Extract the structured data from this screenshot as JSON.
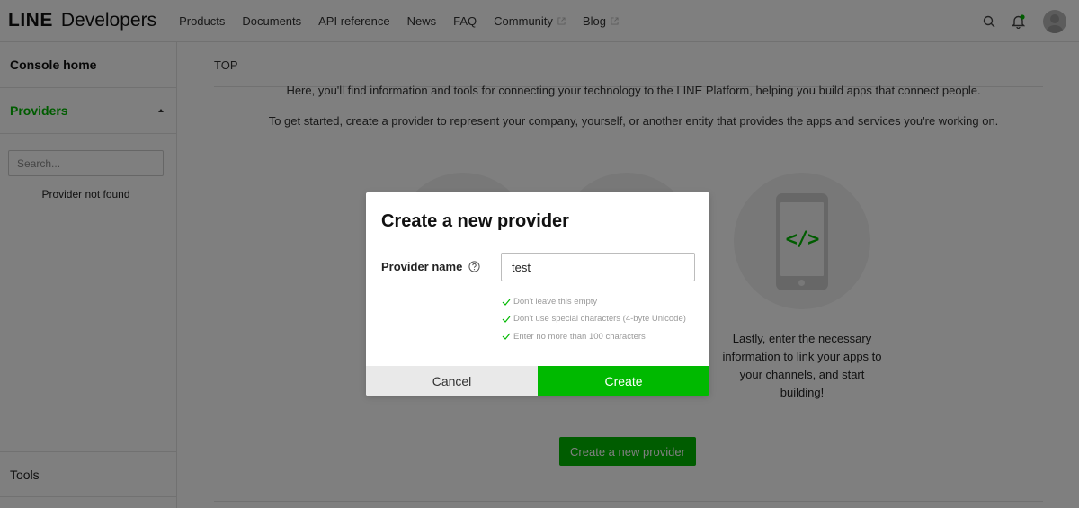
{
  "header": {
    "logo_brand": "LINE",
    "logo_product": "Developers",
    "nav": [
      {
        "label": "Products",
        "external": false
      },
      {
        "label": "Documents",
        "external": false
      },
      {
        "label": "API reference",
        "external": false
      },
      {
        "label": "News",
        "external": false
      },
      {
        "label": "FAQ",
        "external": false
      },
      {
        "label": "Community",
        "external": true
      },
      {
        "label": "Blog",
        "external": true
      }
    ],
    "icons": [
      "search-icon",
      "bell-icon",
      "avatar"
    ]
  },
  "sidebar": {
    "console_home": "Console home",
    "providers": "Providers",
    "search_placeholder": "Search...",
    "empty_text": "Provider not found",
    "tools": "Tools"
  },
  "main": {
    "breadcrumb": "TOP",
    "intro_line1": "Here, you'll find information and tools for connecting your technology to the LINE Platform, helping you build apps that connect people.",
    "intro_line2": "To get started, create a provider to represent your company, yourself, or another entity that provides the apps and services you're working on.",
    "step3_text": "Lastly, enter the necessary information to link your apps to your channels, and start building!",
    "step3_icon": "code-icon",
    "create_provider_button": "Create a new provider"
  },
  "modal": {
    "title": "Create a new provider",
    "field_label": "Provider name",
    "field_value": "test",
    "rules": [
      "Don't leave this empty",
      "Don't use special characters (4-byte Unicode)",
      "Enter no more than 100 characters"
    ],
    "cancel_label": "Cancel",
    "create_label": "Create"
  },
  "colors": {
    "brand_green": "#00b900",
    "overlay": "rgba(0,0,0,0.5)",
    "cancel_bg": "#e9e9e9"
  }
}
